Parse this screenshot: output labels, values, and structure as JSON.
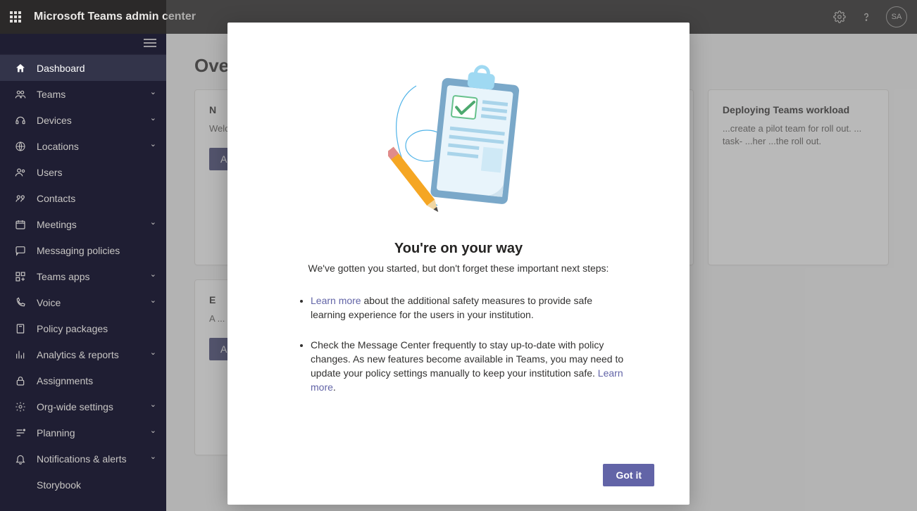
{
  "header": {
    "brand": "Microsoft Teams admin center",
    "avatar_initials": "SA"
  },
  "sidebar": {
    "items": [
      {
        "label": "Dashboard",
        "icon": "home-icon",
        "expandable": false,
        "active": true
      },
      {
        "label": "Teams",
        "icon": "people-team-icon",
        "expandable": true
      },
      {
        "label": "Devices",
        "icon": "headset-icon",
        "expandable": true
      },
      {
        "label": "Locations",
        "icon": "globe-icon",
        "expandable": true
      },
      {
        "label": "Users",
        "icon": "people-icon",
        "expandable": false
      },
      {
        "label": "Contacts",
        "icon": "contacts-icon",
        "expandable": false
      },
      {
        "label": "Meetings",
        "icon": "calendar-icon",
        "expandable": true
      },
      {
        "label": "Messaging policies",
        "icon": "chat-icon",
        "expandable": false
      },
      {
        "label": "Teams apps",
        "icon": "apps-icon",
        "expandable": true
      },
      {
        "label": "Voice",
        "icon": "phone-icon",
        "expandable": true
      },
      {
        "label": "Policy packages",
        "icon": "package-icon",
        "expandable": false
      },
      {
        "label": "Analytics & reports",
        "icon": "analytics-icon",
        "expandable": true
      },
      {
        "label": "Assignments",
        "icon": "lock-icon",
        "expandable": false
      },
      {
        "label": "Org-wide settings",
        "icon": "settings-icon",
        "expandable": true
      },
      {
        "label": "Planning",
        "icon": "planning-icon",
        "expandable": true
      },
      {
        "label": "Notifications & alerts",
        "icon": "bell-icon",
        "expandable": true
      },
      {
        "label": "Storybook",
        "icon": "",
        "expandable": false,
        "sub": true
      }
    ]
  },
  "main": {
    "title": "Overview",
    "card1": {
      "heading": "N",
      "body": "Welcome… Create these important settings so your organization has the best experience across devices and...",
      "button": "Action"
    },
    "card2": {
      "heading": "Deploying Teams workload",
      "body": "...create a pilot team for roll out. ... task- ...her ...the roll out."
    },
    "card3": {
      "heading": "E",
      "body": "A ... a ... n",
      "button": "Action"
    }
  },
  "modal": {
    "title": "You're on your way",
    "subtitle": "We've gotten you started, but don't forget these important next steps:",
    "bullet1_link": "Learn more",
    "bullet1_text": " about the additional safety measures to provide safe learning experience for the users in your institution.",
    "bullet2_text_a": "Check the Message Center frequently to stay up-to-date with policy changes. As new features become available in Teams, you may need to update your policy settings manually to keep your institution safe. ",
    "bullet2_link": "Learn more",
    "bullet2_text_b": ".",
    "button": "Got it"
  }
}
